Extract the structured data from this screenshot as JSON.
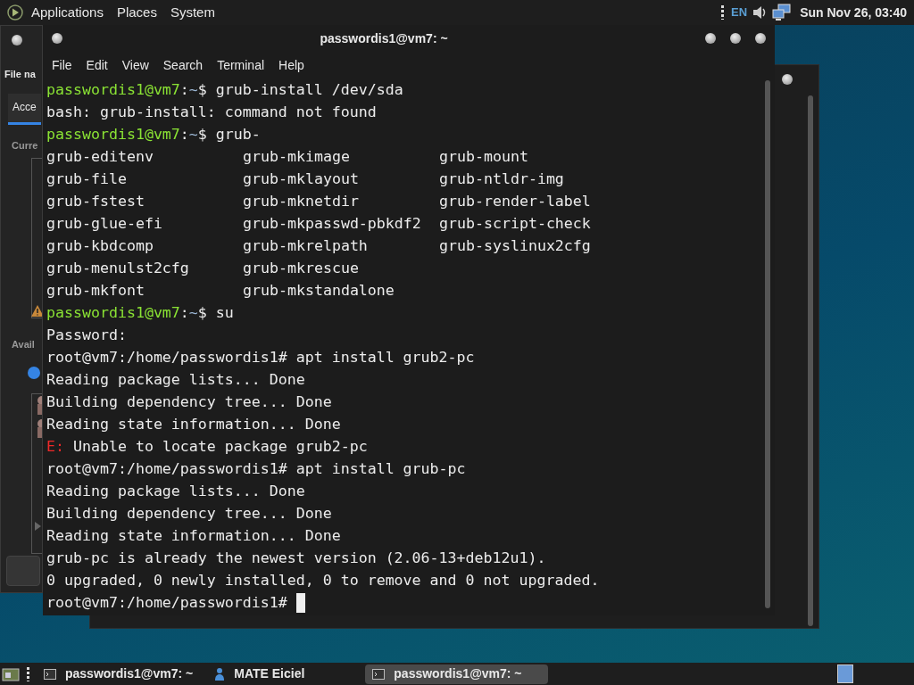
{
  "top_panel": {
    "menus": [
      "Applications",
      "Places",
      "System"
    ],
    "keyboard_layout": "EN",
    "clock": "Sun Nov 26, 03:40"
  },
  "background_window": {
    "title_cut": "File na",
    "tab": "Acce",
    "section_1": "Curre",
    "section_2": "Avail",
    "option": {
      "selected": true
    }
  },
  "terminal": {
    "title": "passwordis1@vm7: ~",
    "menu": [
      "File",
      "Edit",
      "View",
      "Search",
      "Terminal",
      "Help"
    ],
    "lines": [
      {
        "kind": "prompt",
        "user": "passwordis1@vm7",
        "sep": ":",
        "path": "~",
        "text": "$ grub-install /dev/sda"
      },
      {
        "kind": "plain",
        "text": "bash: grub-install: command not found"
      },
      {
        "kind": "prompt",
        "user": "passwordis1@vm7",
        "sep": ":",
        "path": "~",
        "text": "$ grub-"
      },
      {
        "kind": "columns",
        "cells": [
          "grub-editenv",
          "grub-mkimage",
          "grub-mount"
        ]
      },
      {
        "kind": "columns",
        "cells": [
          "grub-file",
          "grub-mklayout",
          "grub-ntldr-img"
        ]
      },
      {
        "kind": "columns",
        "cells": [
          "grub-fstest",
          "grub-mknetdir",
          "grub-render-label"
        ]
      },
      {
        "kind": "columns",
        "cells": [
          "grub-glue-efi",
          "grub-mkpasswd-pbkdf2",
          "grub-script-check"
        ]
      },
      {
        "kind": "columns",
        "cells": [
          "grub-kbdcomp",
          "grub-mkrelpath",
          "grub-syslinux2cfg"
        ]
      },
      {
        "kind": "columns",
        "cells": [
          "grub-menulst2cfg",
          "grub-mkrescue"
        ]
      },
      {
        "kind": "columns",
        "cells": [
          "grub-mkfont",
          "grub-mkstandalone"
        ]
      },
      {
        "kind": "prompt",
        "user": "passwordis1@vm7",
        "sep": ":",
        "path": "~",
        "text": "$ su"
      },
      {
        "kind": "plain",
        "text": "Password:"
      },
      {
        "kind": "plain",
        "text": "root@vm7:/home/passwordis1# apt install grub2-pc"
      },
      {
        "kind": "plain",
        "text": "Reading package lists... Done"
      },
      {
        "kind": "plain",
        "text": "Building dependency tree... Done"
      },
      {
        "kind": "plain",
        "text": "Reading state information... Done"
      },
      {
        "kind": "error",
        "tag": "E:",
        "text": "Unable to locate package grub2-pc"
      },
      {
        "kind": "plain",
        "text": "root@vm7:/home/passwordis1# apt install grub-pc"
      },
      {
        "kind": "plain",
        "text": "Reading package lists... Done"
      },
      {
        "kind": "plain",
        "text": "Building dependency tree... Done"
      },
      {
        "kind": "plain",
        "text": "Reading state information... Done"
      },
      {
        "kind": "plain",
        "text": "grub-pc is already the newest version (2.06-13+deb12u1)."
      },
      {
        "kind": "plain",
        "text": "0 upgraded, 0 newly installed, 0 to remove and 0 not upgraded."
      },
      {
        "kind": "cursor",
        "text": "root@vm7:/home/passwordis1# "
      }
    ]
  },
  "taskbar": {
    "tasks": [
      {
        "kind": "terminal",
        "label": "passwordis1@vm7: ~",
        "selected": false
      },
      {
        "kind": "person",
        "label": "MATE Eiciel",
        "selected": false
      },
      {
        "kind": "terminal",
        "label": "passwordis1@vm7: ~",
        "selected": true
      }
    ]
  }
}
